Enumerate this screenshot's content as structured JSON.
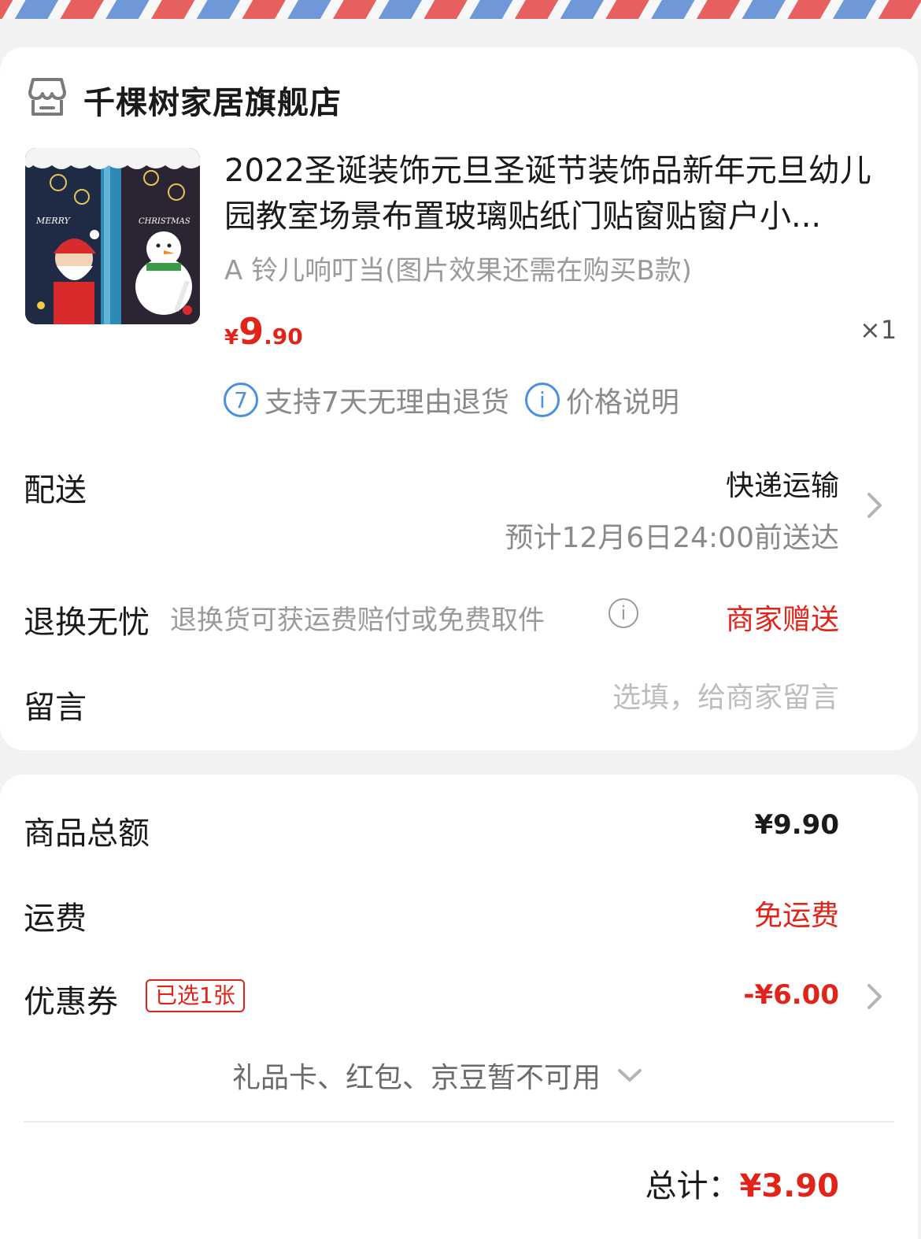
{
  "store": {
    "name": "千棵树家居旗舰店"
  },
  "product": {
    "title": "2022圣诞装饰元旦圣诞节装饰品新年元旦幼儿园教室场景布置玻璃贴纸门贴窗贴窗户小...",
    "variant": "A 铃儿响叮当(图片效果还需在购买B款)",
    "price_symbol": "¥",
    "price_int": "9",
    "price_dec": ".90",
    "quantity": "×1",
    "thumbnail_text_left": "MERRY",
    "thumbnail_text_right": "CHRISTMAS"
  },
  "tags": {
    "return_icon": "7",
    "return_text": "支持7天无理由退货",
    "price_icon": "i",
    "price_text": "价格说明"
  },
  "delivery": {
    "label": "配送",
    "method": "快递运输",
    "eta": "预计12月6日24:00前送达"
  },
  "returns": {
    "label": "退换无忧",
    "desc": "退换货可获运费赔付或免费取件",
    "info_icon": "i",
    "badge": "商家赠送"
  },
  "message": {
    "label": "留言",
    "placeholder": "选填，给商家留言"
  },
  "summary": {
    "goods_label": "商品总额",
    "goods_value": "¥9.90",
    "shipping_label": "运费",
    "shipping_value": "免运费",
    "coupon_label": "优惠券",
    "coupon_badge": "已选1张",
    "coupon_value": "-¥6.00",
    "unavailable_text": "礼品卡、红包、京豆暂不可用",
    "total_label": "总计：",
    "total_value": "¥3.90"
  },
  "colors": {
    "accent_red": "#e2231a",
    "info_blue": "#4a90e2",
    "airmail_red": "#e5605e",
    "airmail_blue": "#6f98d8"
  }
}
